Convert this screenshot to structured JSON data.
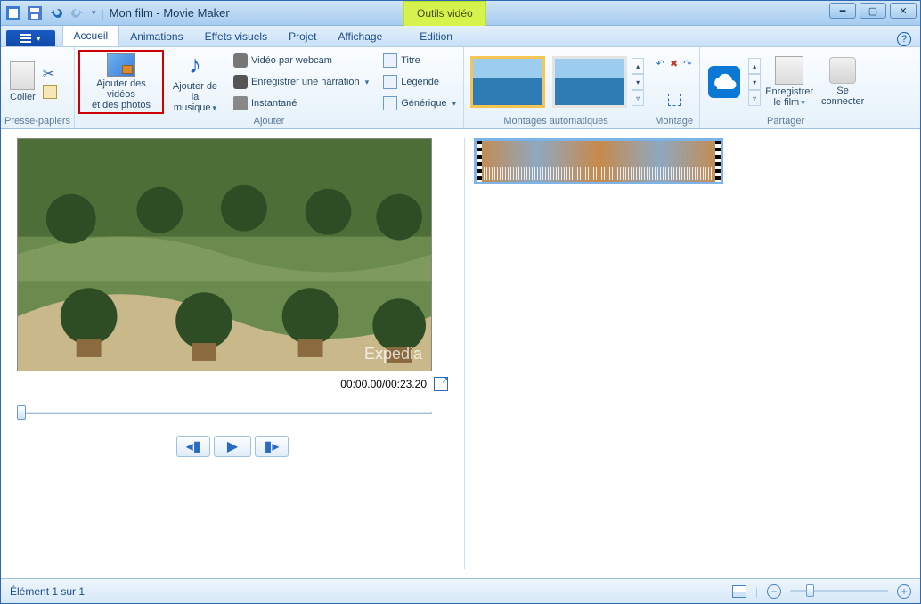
{
  "title": "Mon film - Movie Maker",
  "context_tab": "Outils vidéo",
  "tabs": {
    "accueil": "Accueil",
    "animations": "Animations",
    "effets": "Effets visuels",
    "projet": "Projet",
    "affichage": "Affichage",
    "edition": "Edition"
  },
  "ribbon": {
    "presse_papiers": {
      "label": "Presse-papiers",
      "coller": "Coller"
    },
    "ajouter": {
      "label": "Ajouter",
      "videos_photos": "Ajouter des vidéos\net des photos",
      "musique": "Ajouter de la\nmusique",
      "webcam": "Vidéo par webcam",
      "narration": "Enregistrer une narration",
      "instantane": "Instantané",
      "titre": "Titre",
      "legende": "Légende",
      "generique": "Générique"
    },
    "montages_auto": {
      "label": "Montages automatiques"
    },
    "montage": {
      "label": "Montage"
    },
    "partager": {
      "label": "Partager",
      "enregistrer": "Enregistrer\nle film",
      "connecter": "Se\nconnecter"
    }
  },
  "preview": {
    "watermark": "Expedia",
    "time": "00:00.00/00:23.20"
  },
  "status": {
    "left": "Élément 1 sur 1"
  }
}
